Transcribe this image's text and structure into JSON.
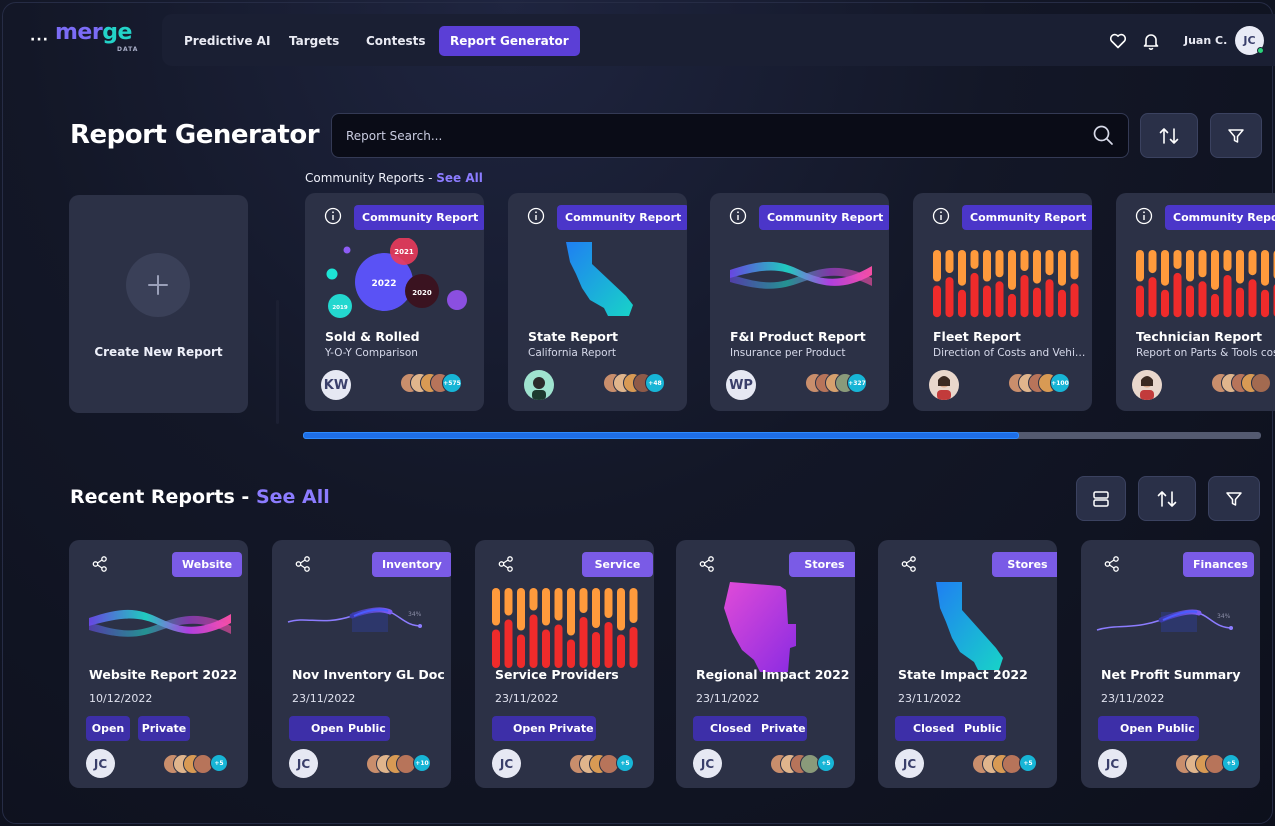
{
  "nav": {
    "menu_dots": "···",
    "logo_text_1": "mer",
    "logo_text_2": "ge",
    "logo_sub": "DATA",
    "items": [
      {
        "label": "Predictive AI"
      },
      {
        "label": "Targets"
      },
      {
        "label": "Contests"
      },
      {
        "label": "Report Generator",
        "active": true
      }
    ],
    "icons": [
      "heart-icon",
      "bell-icon"
    ],
    "user_name": "Juan C.",
    "user_initials": "JC"
  },
  "header": {
    "title": "Report Generator",
    "search_placeholder": "Report Search...",
    "icons": [
      "search-icon",
      "sort-icon",
      "filter-icon"
    ]
  },
  "community": {
    "title": "Community Reports - ",
    "see_all": "See All",
    "create_label": "Create New Report",
    "cards": [
      {
        "badge": "Community Report",
        "title": "Sold & Rolled",
        "subtitle": "Y-O-Y Comparison",
        "owner": "KW",
        "count": "+575",
        "chart": "bubbles"
      },
      {
        "badge": "Community Report",
        "title": "State Report",
        "subtitle": "California Report",
        "owner": "",
        "count": "+48",
        "chart": "california"
      },
      {
        "badge": "Community Report",
        "title": "F&I Product Report",
        "subtitle": "Insurance per Product",
        "owner": "WP",
        "count": "+327",
        "chart": "ribbon"
      },
      {
        "badge": "Community Report",
        "title": "Fleet Report",
        "subtitle": "Direction of Costs and Vehicles",
        "owner": "",
        "count": "+100",
        "chart": "bars"
      },
      {
        "badge": "Community Report",
        "title": "Technician Report",
        "subtitle": "Report on Parts & Tools cost",
        "owner": "",
        "count": "",
        "chart": "bars"
      }
    ],
    "bubbles": [
      {
        "label": "2021"
      },
      {
        "label": "2022"
      },
      {
        "label": "2020"
      },
      {
        "label": "2019"
      }
    ],
    "scroll_progress": 0.747
  },
  "recent": {
    "title": "Recent Reports - ",
    "see_all": "See All",
    "icons": [
      "layout-icon",
      "sort-icon",
      "filter-icon"
    ],
    "cards": [
      {
        "badge": "Website",
        "title": "Website Report 2022",
        "date": "10/12/2022",
        "status": "Open",
        "visibility": "Private",
        "owner": "JC",
        "count": "+5",
        "chart": "ribbon",
        "grouped": false
      },
      {
        "badge": "Inventory",
        "title": "Nov Inventory GL Doc",
        "date": "23/11/2022",
        "status": "Open",
        "visibility": "Public",
        "owner": "JC",
        "count": "+10",
        "chart": "wave",
        "wave_label": "34%",
        "grouped": true
      },
      {
        "badge": "Service",
        "title": "Service Providers",
        "date": "23/11/2022",
        "status": "Open",
        "visibility": "Private",
        "owner": "JC",
        "count": "+5",
        "chart": "bars",
        "grouped": true
      },
      {
        "badge": "Stores",
        "title": "Regional Impact 2022",
        "date": "23/11/2022",
        "status": "Closed",
        "visibility": "Private",
        "owner": "JC",
        "count": "+5",
        "chart": "westus",
        "grouped": true
      },
      {
        "badge": "Stores",
        "title": "State Impact 2022",
        "date": "23/11/2022",
        "status": "Closed",
        "visibility": "Public",
        "owner": "JC",
        "count": "+5",
        "chart": "california",
        "grouped": true
      },
      {
        "badge": "Finances",
        "title": "Net Profit Summary",
        "date": "23/11/2022",
        "status": "Open",
        "visibility": "Public",
        "owner": "JC",
        "count": "+5",
        "chart": "wave",
        "wave_label": "34%",
        "grouped": true
      }
    ]
  },
  "colors": {
    "accent": "#5b3fd6",
    "badge_community": "#4b36c9",
    "badge_recent": "#7a5be6",
    "link": "#8c7cff",
    "card_bg": "#2c3146",
    "bar_red": "#ef2b2b",
    "bar_orange": "#ff9a3c"
  }
}
